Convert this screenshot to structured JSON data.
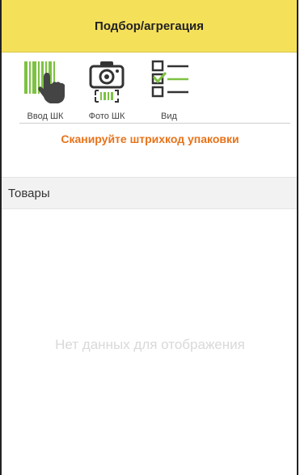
{
  "header": {
    "title": "Подбор/агрегация"
  },
  "toolbar": {
    "items": [
      {
        "label": "Ввод ШК",
        "icon": "barcode-hand-icon"
      },
      {
        "label": "Фото ШК",
        "icon": "camera-barcode-icon"
      },
      {
        "label": "Вид",
        "icon": "checklist-icon"
      }
    ]
  },
  "prompt": {
    "text": "Сканируйте штрихкод упаковки"
  },
  "goods": {
    "title": "Товары",
    "empty_text": "Нет данных для отображения"
  },
  "colors": {
    "header_bg": "#f5e05a",
    "accent_green": "#7dc242",
    "prompt_orange": "#e8731a"
  }
}
